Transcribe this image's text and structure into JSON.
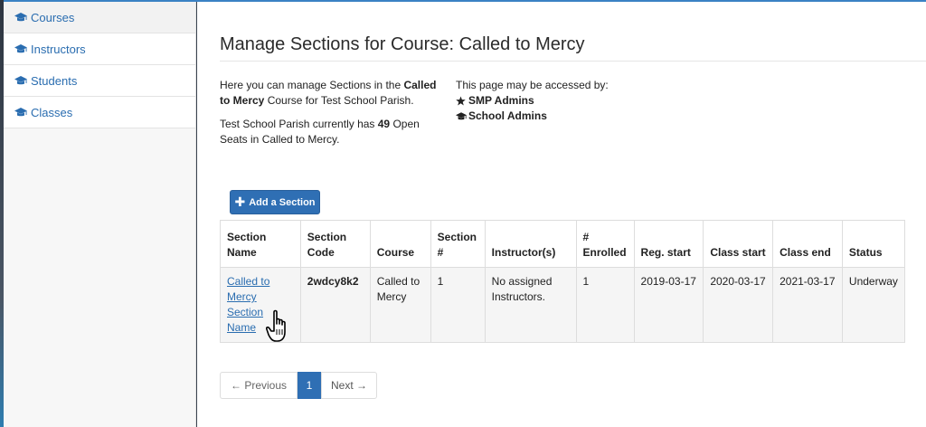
{
  "sidebar": {
    "items": [
      {
        "label": "Courses",
        "icon": "graduation-cap-icon"
      },
      {
        "label": "Instructors",
        "icon": "graduation-cap-icon"
      },
      {
        "label": "Students",
        "icon": "graduation-cap-icon"
      },
      {
        "label": "Classes",
        "icon": "graduation-cap-icon"
      }
    ]
  },
  "header": {
    "title": "Manage Sections for Course: Called to Mercy"
  },
  "intro": {
    "line1_a": "Here you can manage Sections in the",
    "course_name": "Called to Mercy",
    "line1_b": " Course for Test School Parish.",
    "line2_a": "Test School Parish currently has ",
    "open_seats": "49",
    "line2_b": " Open Seats in Called to Mercy."
  },
  "access": {
    "heading": "This page may be accessed by:",
    "roles": [
      {
        "label": "SMP Admins",
        "icon": "star-icon"
      },
      {
        "label": "School Admins",
        "icon": "graduation-cap-icon"
      }
    ]
  },
  "actions": {
    "add_section": "Add a Section"
  },
  "table": {
    "headers": [
      "Section Name",
      "Section Code",
      "Course",
      "Section #",
      "Instructor(s)",
      "# Enrolled",
      "Reg. start",
      "Class start",
      "Class end",
      "Status"
    ],
    "rows": [
      [
        "Called to Mercy Section Name",
        "2wdcy8k2",
        "Called to Mercy",
        "1",
        "No assigned Instructors.",
        "1",
        "2019-03-17",
        "2020-03-17",
        "2021-03-17",
        "Underway"
      ]
    ]
  },
  "pagination": {
    "previous": "← Previous",
    "current": "1",
    "next": "Next →"
  },
  "colors": {
    "accent": "#2f6fb4",
    "link": "#2a6db0"
  }
}
